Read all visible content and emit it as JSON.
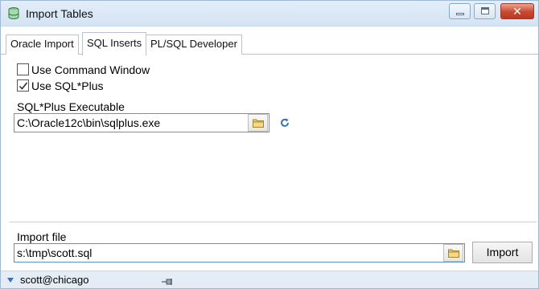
{
  "window": {
    "title": "Import Tables",
    "buttons": {
      "minimize": "minimize",
      "maximize": "maximize",
      "close": "✕"
    }
  },
  "tabs": [
    {
      "label": "Oracle Import",
      "active": false
    },
    {
      "label": "SQL Inserts",
      "active": true
    },
    {
      "label": "PL/SQL Developer",
      "active": false
    }
  ],
  "options": {
    "use_command_window": {
      "label": "Use Command Window",
      "checked": false
    },
    "use_sqlplus": {
      "label": "Use SQL*Plus",
      "checked": true
    }
  },
  "sqlplus": {
    "label": "SQL*Plus Executable",
    "value": "C:\\Oracle12c\\bin\\sqlplus.exe",
    "browse_icon": "folder-icon",
    "refresh_icon": "refresh-icon"
  },
  "import": {
    "file_label": "Import file",
    "file_value": "s:\\tmp\\scott.sql",
    "button_label": "Import"
  },
  "status": {
    "connection": "scott@chicago"
  },
  "colors": {
    "titlebar": "#dbe8f6",
    "close_button": "#c9482f",
    "refresh_icon": "#3d6fb5",
    "focus_border": "#5b8fd1"
  }
}
